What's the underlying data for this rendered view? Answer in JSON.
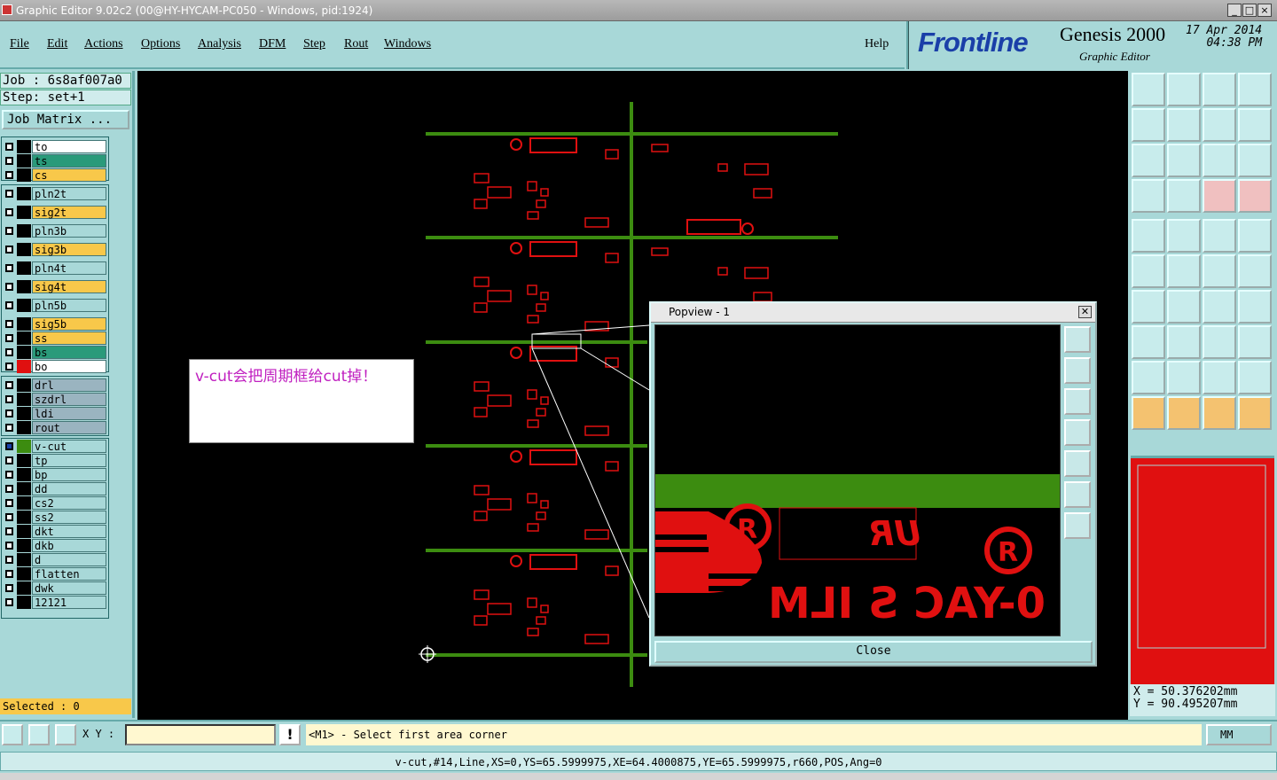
{
  "window": {
    "title": "Graphic Editor 9.02c2 (00@HY-HYCAM-PC050 - Windows, pid:1924)"
  },
  "menu": {
    "items": [
      "File",
      "Edit",
      "Actions",
      "Options",
      "Analysis",
      "DFM",
      "Step",
      "Rout",
      "Windows"
    ],
    "help": "Help"
  },
  "logo": {
    "brand": "Frontline",
    "product": "Genesis 2000",
    "subtitle": "Graphic Editor",
    "date": "17 Apr 2014",
    "time": "04:38 PM"
  },
  "job": {
    "job": "Job  : 6s8af007a0",
    "step": "Step: set+1",
    "matrix_button": "Job Matrix ..."
  },
  "layers": [
    {
      "name": "to",
      "color": "#ffffff"
    },
    {
      "name": "ts",
      "color": "#2a9a7a"
    },
    {
      "name": "cs",
      "color": "#f8c84a"
    },
    {
      "name": "pln2t",
      "color": "#a8d8d8"
    },
    {
      "name": "sig2t",
      "color": "#f8c84a"
    },
    {
      "name": "pln3b",
      "color": "#a8d8d8"
    },
    {
      "name": "sig3b",
      "color": "#f8c84a"
    },
    {
      "name": "pln4t",
      "color": "#a8d8d8"
    },
    {
      "name": "sig4t",
      "color": "#f8c84a"
    },
    {
      "name": "pln5b",
      "color": "#a8d8d8"
    },
    {
      "name": "sig5b",
      "color": "#f8c84a"
    },
    {
      "name": "ss",
      "color": "#f8c84a"
    },
    {
      "name": "bs",
      "color": "#2a9a7a"
    },
    {
      "name": "bo",
      "color": "#ffffff"
    },
    {
      "name": "drl",
      "color": "#9ab4c0"
    },
    {
      "name": "szdrl",
      "color": "#9ab4c0"
    },
    {
      "name": "ldi",
      "color": "#9ab4c0"
    },
    {
      "name": "rout",
      "color": "#9ab4c0"
    },
    {
      "name": "v-cut",
      "color": "#a8d8d8"
    },
    {
      "name": "tp",
      "color": "#a8d8d8"
    },
    {
      "name": "bp",
      "color": "#a8d8d8"
    },
    {
      "name": "dd",
      "color": "#a8d8d8"
    },
    {
      "name": "cs2",
      "color": "#a8d8d8"
    },
    {
      "name": "ss2",
      "color": "#a8d8d8"
    },
    {
      "name": "dkt",
      "color": "#a8d8d8"
    },
    {
      "name": "dkb",
      "color": "#a8d8d8"
    },
    {
      "name": "d",
      "color": "#a8d8d8"
    },
    {
      "name": "flatten",
      "color": "#a8d8d8"
    },
    {
      "name": "dwk",
      "color": "#a8d8d8"
    },
    {
      "name": "12121",
      "color": "#a8d8d8"
    }
  ],
  "selected": "Selected : 0",
  "note": "v-cut会把周期框给cut掉！",
  "popview": {
    "title": "Popview - 1",
    "close": "Close",
    "mirrored_text": "0-YAC S ILM",
    "mirrored_text2": "UR"
  },
  "coords": {
    "x": "X  =  50.376202mm",
    "y": "Y  =  90.495207mm"
  },
  "command": {
    "xy_label": "X Y :",
    "xy_value": "",
    "prompt": "<M1> - Select first area corner",
    "units": "MM"
  },
  "status": "v-cut,#14,Line,XS=0,YS=65.5999975,XE=64.4000875,YE=65.5999975,r660,POS,Ang=0",
  "colors": {
    "bg": "#a8d8d8",
    "vcut": "#3c8c10",
    "feature": "#e01010",
    "brand": "#1a3fa8"
  }
}
